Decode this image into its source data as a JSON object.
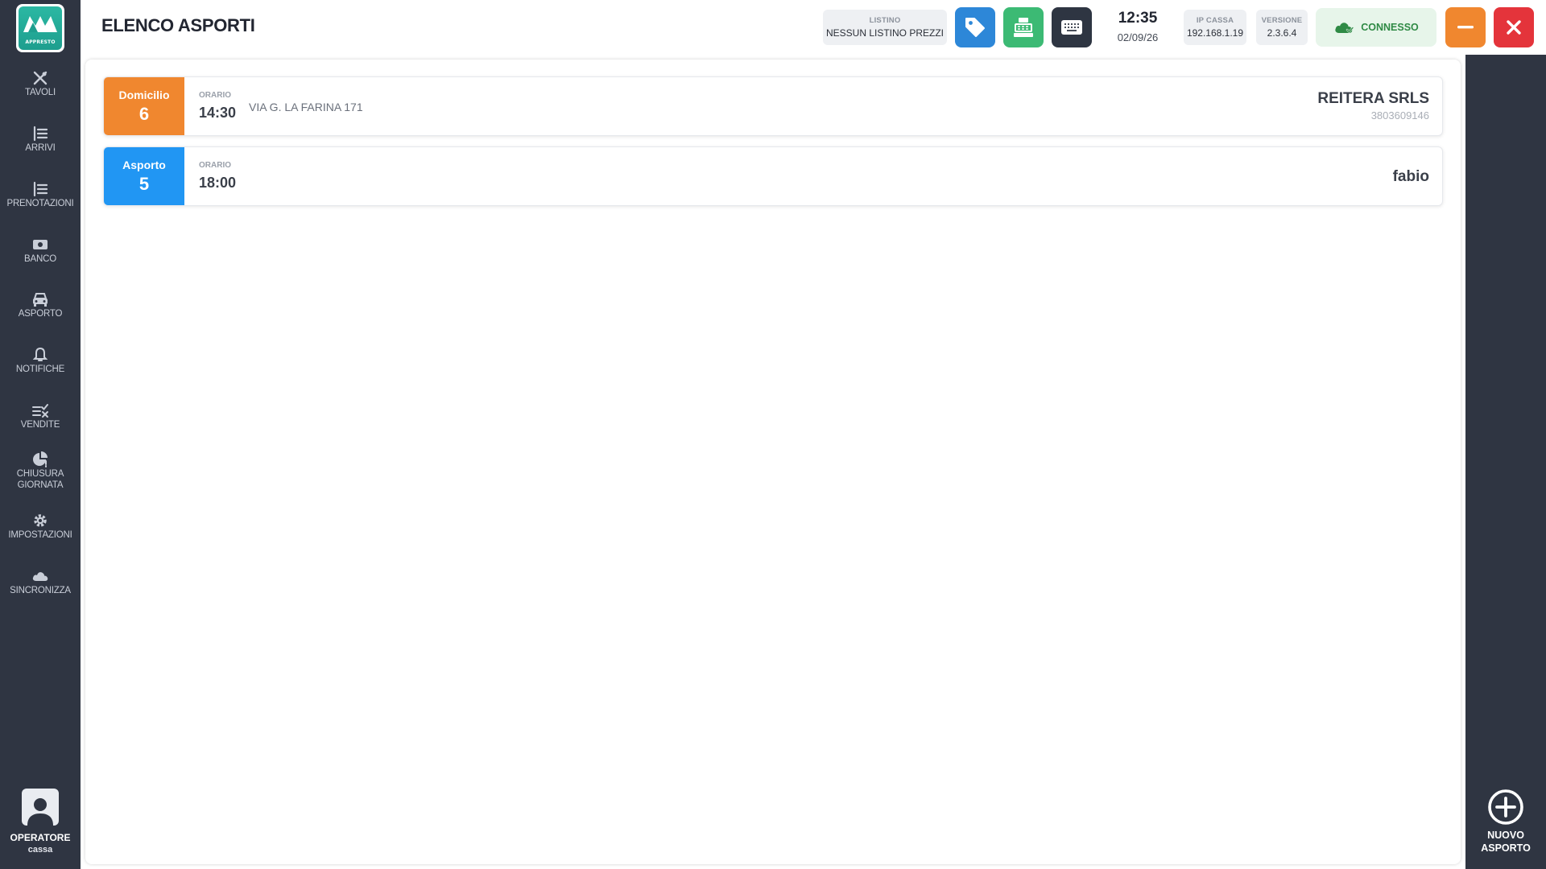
{
  "app": {
    "logo_text": "APPRESTO"
  },
  "sidebar": {
    "items": [
      {
        "label": "TAVOLI",
        "icon": "cutlery-icon"
      },
      {
        "label": "ARRIVI",
        "icon": "list-icon"
      },
      {
        "label": "PRENOTAZIONI",
        "icon": "list-icon"
      },
      {
        "label": "BANCO",
        "icon": "cash-icon"
      },
      {
        "label": "ASPORTO",
        "icon": "car-icon"
      },
      {
        "label": "NOTIFICHE",
        "icon": "bell-icon"
      },
      {
        "label": "VENDITE",
        "icon": "sales-icon"
      },
      {
        "label": "CHIUSURA",
        "label2": "GIORNATA",
        "icon": "day-close-icon"
      },
      {
        "label": "IMPOSTAZIONI",
        "icon": "gear-icon"
      },
      {
        "label": "SINCRONIZZA",
        "icon": "cloud-icon"
      }
    ],
    "operator": {
      "role": "OPERATORE",
      "user": "cassa"
    }
  },
  "header": {
    "title": "ELENCO ASPORTI",
    "listino": {
      "label": "LISTINO",
      "value": "NESSUN LISTINO PREZZI"
    },
    "clock": {
      "time": "12:35",
      "date": "02/09/26"
    },
    "ip": {
      "label": "IP CASSA",
      "value": "192.168.1.19"
    },
    "version": {
      "label": "VERSIONE",
      "value": "2.3.6.4"
    },
    "connection": {
      "label": "CONNESSO",
      "color": "#2f8a45"
    }
  },
  "orders": [
    {
      "type": "Domicilio",
      "number": "6",
      "time_label": "ORARIO",
      "time": "14:30",
      "address": "VIA G. LA FARINA 171",
      "customer": "REITERA SRLS",
      "phone": "3803609146",
      "color": "#f0872f"
    },
    {
      "type": "Asporto",
      "number": "5",
      "time_label": "ORARIO",
      "time": "18:00",
      "address": "",
      "customer": "fabio",
      "phone": "",
      "color": "#2196f3"
    }
  ],
  "rightbar": {
    "new_label_1": "NUOVO",
    "new_label_2": "ASPORTO"
  },
  "colors": {
    "sidebar_bg": "#2f3542",
    "accent_blue": "#2d87d8",
    "accent_green": "#3cba74",
    "warning_orange": "#f0872f",
    "danger_red": "#e4343b"
  }
}
